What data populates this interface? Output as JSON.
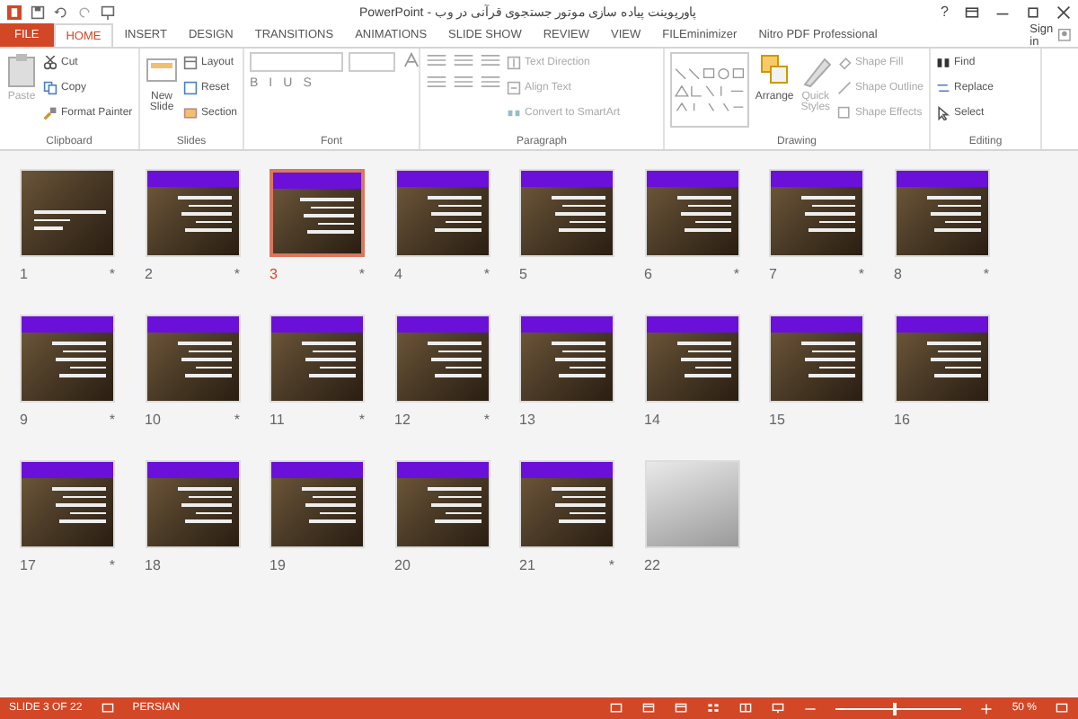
{
  "window": {
    "title": "پاورپوینت پیاده سازی موتور جستجوی قرآنی در وب - PowerPoint",
    "controls": [
      "?"
    ],
    "sign_in": "Sign in"
  },
  "tabs": [
    {
      "label": "FILE",
      "kind": "file",
      "selected": false
    },
    {
      "label": "HOME",
      "kind": "tab",
      "selected": true
    },
    {
      "label": "INSERT",
      "kind": "tab",
      "selected": false
    },
    {
      "label": "DESIGN",
      "kind": "tab",
      "selected": false
    },
    {
      "label": "TRANSITIONS",
      "kind": "tab",
      "selected": false
    },
    {
      "label": "ANIMATIONS",
      "kind": "tab",
      "selected": false
    },
    {
      "label": "SLIDE SHOW",
      "kind": "tab",
      "selected": false
    },
    {
      "label": "REVIEW",
      "kind": "tab",
      "selected": false
    },
    {
      "label": "VIEW",
      "kind": "tab",
      "selected": false
    },
    {
      "label": "FILEminimizer",
      "kind": "tab",
      "selected": false
    },
    {
      "label": "Nitro PDF Professional",
      "kind": "tab",
      "selected": false
    }
  ],
  "ribbon": {
    "clipboard": {
      "label": "Clipboard",
      "paste": "Paste",
      "items": [
        "Cut",
        "Copy",
        "Format Painter"
      ]
    },
    "slides": {
      "label": "Slides",
      "new_slide": "New Slide",
      "items": [
        "Layout",
        "Reset",
        "Section"
      ]
    },
    "font": {
      "label": "Font",
      "format_buttons": [
        "B",
        "I",
        "U",
        "S"
      ]
    },
    "paragraph": {
      "label": "Paragraph",
      "items": [
        "Text Direction",
        "Align Text",
        "Convert to SmartArt"
      ]
    },
    "drawing": {
      "label": "Drawing",
      "arrange": "Arrange",
      "quick_styles": "Quick Styles",
      "items": [
        "Shape Fill",
        "Shape Outline",
        "Shape Effects"
      ]
    },
    "editing": {
      "label": "Editing",
      "items": [
        "Find",
        "Replace",
        "Select"
      ]
    }
  },
  "slides": [
    {
      "number": "1",
      "kind": "title",
      "mark": "*",
      "selected": false
    },
    {
      "number": "2",
      "kind": "content",
      "mark": "*",
      "selected": false
    },
    {
      "number": "3",
      "kind": "content",
      "mark": "*",
      "selected": true
    },
    {
      "number": "4",
      "kind": "content",
      "mark": "*",
      "selected": false
    },
    {
      "number": "5",
      "kind": "content",
      "selected": false
    },
    {
      "number": "6",
      "kind": "content",
      "mark": "*",
      "selected": false
    },
    {
      "number": "7",
      "kind": "content",
      "mark": "*",
      "selected": false
    },
    {
      "number": "8",
      "kind": "content",
      "mark": "*",
      "selected": false
    },
    {
      "number": "9",
      "kind": "content",
      "mark": "*",
      "selected": false
    },
    {
      "number": "10",
      "kind": "content",
      "mark": "*",
      "selected": false
    },
    {
      "number": "11",
      "kind": "content",
      "mark": "*",
      "selected": false
    },
    {
      "number": "12",
      "kind": "content",
      "mark": "*",
      "selected": false
    },
    {
      "number": "13",
      "kind": "content",
      "selected": false
    },
    {
      "number": "14",
      "kind": "content",
      "selected": false
    },
    {
      "number": "15",
      "kind": "content",
      "selected": false
    },
    {
      "number": "16",
      "kind": "content",
      "selected": false
    },
    {
      "number": "17",
      "kind": "content",
      "mark": "*",
      "selected": false
    },
    {
      "number": "18",
      "kind": "content",
      "selected": false
    },
    {
      "number": "19",
      "kind": "content",
      "selected": false
    },
    {
      "number": "20",
      "kind": "content",
      "selected": false
    },
    {
      "number": "21",
      "kind": "content",
      "mark": "*",
      "selected": false
    },
    {
      "number": "22",
      "kind": "photo",
      "selected": false
    }
  ],
  "status_bar": {
    "slide": "SLIDE 3 OF 22",
    "language": "PERSIAN",
    "zoom": "50 %",
    "zoom_slider": {
      "level": 0.45
    }
  }
}
